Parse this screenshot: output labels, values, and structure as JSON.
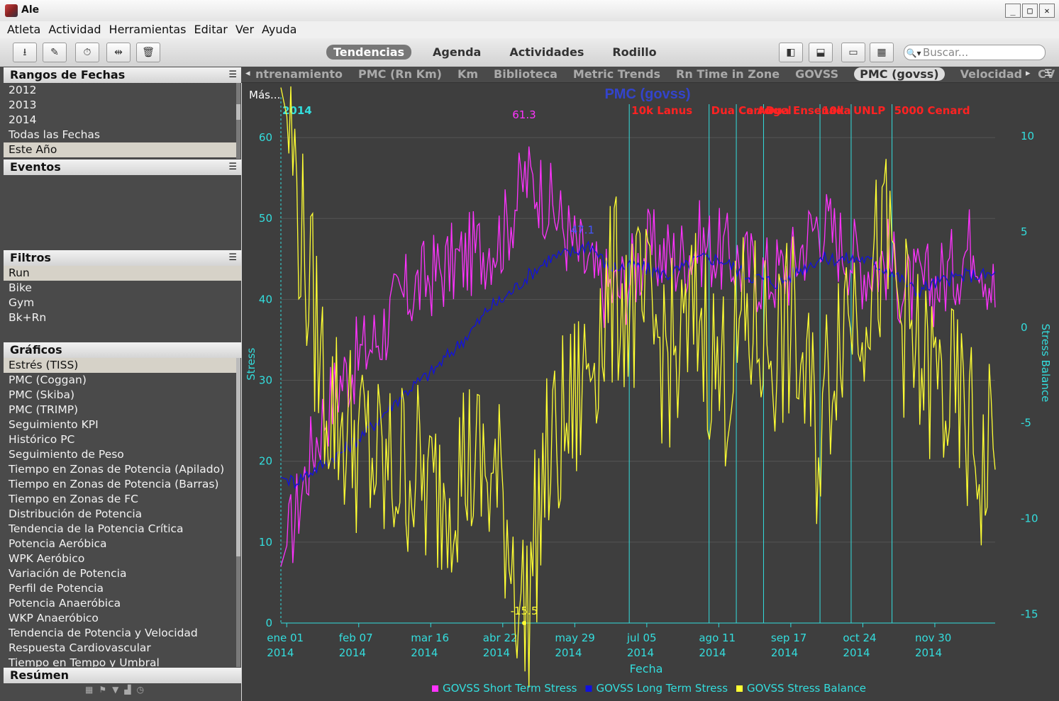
{
  "window": {
    "title": "Ale"
  },
  "menu": [
    "Atleta",
    "Actividad",
    "Herramientas",
    "Editar",
    "Ver",
    "Ayuda"
  ],
  "toolbar": {
    "views": [
      "Tendencias",
      "Agenda",
      "Actividades",
      "Rodillo"
    ],
    "active_view": "Tendencias",
    "search_placeholder": "Buscar..."
  },
  "sidebar": {
    "rangos": {
      "title": "Rangos de Fechas",
      "items": [
        "2012",
        "2013",
        "2014",
        "Todas las Fechas",
        "Este Año"
      ],
      "selected": "Este Año"
    },
    "eventos": {
      "title": "Eventos"
    },
    "filtros": {
      "title": "Filtros",
      "items": [
        "Run",
        "Bike",
        "Gym",
        "Bk+Rn"
      ],
      "selected": "Run"
    },
    "graficos": {
      "title": "Gráficos",
      "items": [
        "Estrés (TISS)",
        "PMC (Coggan)",
        "PMC (Skiba)",
        "PMC (TRIMP)",
        "Seguimiento KPI",
        "Histórico PC",
        "Seguimiento de Peso",
        "Tiempo en Zonas de Potencia (Apilado)",
        "Tiempo en Zonas de Potencia (Barras)",
        "Tiempo en Zonas de FC",
        "Distribución de Potencia",
        "Tendencia de la Potencia Crítica",
        "Potencia Aeróbica",
        "WPK Aeróbico",
        "Variación de Potencia",
        "Perfil de Potencia",
        "Potencia Anaeróbica",
        "WKP Anaeróbico",
        "Tendencia de Potencia y Velocidad",
        "Respuesta Cardiovascular",
        "Tiempo en Tempo y Umbral"
      ],
      "selected": "Estrés (TISS)"
    },
    "resumen": {
      "title": "Resúmen"
    }
  },
  "chart_tabs": [
    "ntrenamiento",
    "PMC (Rn Km)",
    "Km",
    "Biblioteca",
    "Metric Trends",
    "Rn Time in Zone",
    "GOVSS",
    "PMC (govss)",
    "Velocidad",
    "CV"
  ],
  "active_chart_tab": "PMC (govss)",
  "mas_label": "Más...",
  "chart_data": {
    "type": "line",
    "title": "PMC (govss)",
    "xlabel": "Fecha",
    "ylabel": "Stress",
    "y2label": "Stress Balance",
    "x_range": [
      "2013-12-29",
      "2014-12-31"
    ],
    "ylim": [
      0,
      65
    ],
    "y2lim": [
      -15.5,
      12
    ],
    "yticks": [
      0,
      10,
      20,
      30,
      40,
      50,
      60
    ],
    "y2ticks": [
      -15,
      -10,
      -5,
      0,
      5,
      10
    ],
    "xticks": [
      {
        "date": "2014-01-01",
        "label1": "ene 01",
        "label2": "2014"
      },
      {
        "date": "2014-02-07",
        "label1": "feb 07",
        "label2": "2014"
      },
      {
        "date": "2014-03-16",
        "label1": "mar 16",
        "label2": "2014"
      },
      {
        "date": "2014-04-22",
        "label1": "abr 22",
        "label2": "2014"
      },
      {
        "date": "2014-05-29",
        "label1": "may 29",
        "label2": "2014"
      },
      {
        "date": "2014-07-05",
        "label1": "jul 05",
        "label2": "2014"
      },
      {
        "date": "2014-08-11",
        "label1": "ago 11",
        "label2": "2014"
      },
      {
        "date": "2014-09-17",
        "label1": "sep 17",
        "label2": "2014"
      },
      {
        "date": "2014-10-24",
        "label1": "oct 24",
        "label2": "2014"
      },
      {
        "date": "2014-11-30",
        "label1": "nov 30",
        "label2": "2014"
      }
    ],
    "year_marker": {
      "date": "2013-12-29",
      "label": "2014"
    },
    "events": [
      {
        "date": "2014-06-26",
        "label": "10k Lanus"
      },
      {
        "date": "2014-08-06",
        "label": "Dua Cerro"
      },
      {
        "date": "2014-08-20",
        "label": "Ca Angel"
      },
      {
        "date": "2014-09-03",
        "label": "Dua Ensenada"
      },
      {
        "date": "2014-10-02",
        "label": "10k"
      },
      {
        "date": "2014-10-18",
        "label": "UNLP"
      },
      {
        "date": "2014-11-08",
        "label": "5000 Cenard"
      }
    ],
    "annotations": [
      {
        "series": "GOVSS Short Term Stress",
        "date": "2014-05-03",
        "value": 61.3,
        "label": "61.3"
      },
      {
        "series": "GOVSS Long Term Stress",
        "date": "2014-06-02",
        "value": 47.1,
        "label": "47.1"
      },
      {
        "series": "GOVSS Stress Balance",
        "date": "2014-05-03",
        "value": -15.5,
        "label": "-15.5"
      }
    ],
    "series": [
      {
        "name": "GOVSS Short Term Stress",
        "color": "#ff33ff",
        "axis": "left",
        "points": [
          [
            "2013-12-29",
            7
          ],
          [
            "2014-01-05",
            13
          ],
          [
            "2014-01-12",
            20
          ],
          [
            "2014-01-20",
            26
          ],
          [
            "2014-01-28",
            30
          ],
          [
            "2014-02-07",
            33
          ],
          [
            "2014-02-18",
            36
          ],
          [
            "2014-03-01",
            40
          ],
          [
            "2014-03-16",
            43
          ],
          [
            "2014-04-01",
            45
          ],
          [
            "2014-04-15",
            47
          ],
          [
            "2014-04-22",
            48
          ],
          [
            "2014-05-03",
            55
          ],
          [
            "2014-05-10",
            54
          ],
          [
            "2014-05-20",
            50
          ],
          [
            "2014-05-29",
            46
          ],
          [
            "2014-06-10",
            42
          ],
          [
            "2014-06-20",
            41
          ],
          [
            "2014-07-05",
            46
          ],
          [
            "2014-07-20",
            45
          ],
          [
            "2014-08-01",
            47
          ],
          [
            "2014-08-11",
            46
          ],
          [
            "2014-08-25",
            44
          ],
          [
            "2014-09-05",
            43
          ],
          [
            "2014-09-17",
            44
          ],
          [
            "2014-10-01",
            50
          ],
          [
            "2014-10-12",
            47
          ],
          [
            "2014-10-24",
            44
          ],
          [
            "2014-11-05",
            45
          ],
          [
            "2014-11-15",
            41
          ],
          [
            "2014-11-30",
            42
          ],
          [
            "2014-12-10",
            44
          ],
          [
            "2014-12-20",
            48
          ],
          [
            "2014-12-31",
            40
          ]
        ]
      },
      {
        "name": "GOVSS Long Term Stress",
        "color": "#1111dd",
        "axis": "left",
        "points": [
          [
            "2013-12-29",
            18
          ],
          [
            "2014-01-05",
            17.5
          ],
          [
            "2014-01-15",
            19
          ],
          [
            "2014-01-28",
            21
          ],
          [
            "2014-02-07",
            23
          ],
          [
            "2014-02-20",
            26
          ],
          [
            "2014-03-05",
            29
          ],
          [
            "2014-03-16",
            31
          ],
          [
            "2014-04-01",
            35
          ],
          [
            "2014-04-15",
            39
          ],
          [
            "2014-04-22",
            40
          ],
          [
            "2014-05-05",
            43
          ],
          [
            "2014-05-15",
            45
          ],
          [
            "2014-05-29",
            46
          ],
          [
            "2014-06-05",
            47
          ],
          [
            "2014-06-15",
            44
          ],
          [
            "2014-07-01",
            44
          ],
          [
            "2014-07-15",
            43
          ],
          [
            "2014-08-01",
            45
          ],
          [
            "2014-08-11",
            45
          ],
          [
            "2014-08-25",
            43
          ],
          [
            "2014-09-10",
            42
          ],
          [
            "2014-09-17",
            43
          ],
          [
            "2014-10-01",
            45
          ],
          [
            "2014-10-24",
            45
          ],
          [
            "2014-11-10",
            43
          ],
          [
            "2014-11-20",
            41
          ],
          [
            "2014-11-30",
            42
          ],
          [
            "2014-12-15",
            43
          ],
          [
            "2014-12-31",
            43
          ]
        ]
      },
      {
        "name": "GOVSS Stress Balance",
        "color": "#ffff33",
        "axis": "right",
        "points": [
          [
            "2013-12-29",
            12.5
          ],
          [
            "2014-01-03",
            10
          ],
          [
            "2014-01-08",
            5
          ],
          [
            "2014-01-14",
            1
          ],
          [
            "2014-01-20",
            -3
          ],
          [
            "2014-01-28",
            -5
          ],
          [
            "2014-02-07",
            -6
          ],
          [
            "2014-02-20",
            -8
          ],
          [
            "2014-03-05",
            -7
          ],
          [
            "2014-03-16",
            -9
          ],
          [
            "2014-04-01",
            -7
          ],
          [
            "2014-04-15",
            -8
          ],
          [
            "2014-04-22",
            -9
          ],
          [
            "2014-05-03",
            -15.5
          ],
          [
            "2014-05-12",
            -8
          ],
          [
            "2014-05-20",
            -6
          ],
          [
            "2014-05-29",
            -4
          ],
          [
            "2014-06-10",
            0
          ],
          [
            "2014-06-20",
            2
          ],
          [
            "2014-07-05",
            0
          ],
          [
            "2014-07-20",
            -2
          ],
          [
            "2014-08-01",
            1
          ],
          [
            "2014-08-11",
            -3
          ],
          [
            "2014-08-25",
            0
          ],
          [
            "2014-09-10",
            -1
          ],
          [
            "2014-09-17",
            0
          ],
          [
            "2014-10-01",
            -6
          ],
          [
            "2014-10-12",
            1
          ],
          [
            "2014-10-24",
            2
          ],
          [
            "2014-11-05",
            4
          ],
          [
            "2014-11-20",
            -2
          ],
          [
            "2014-11-30",
            -3
          ],
          [
            "2014-12-15",
            -5
          ],
          [
            "2014-12-25",
            -8
          ],
          [
            "2014-12-31",
            -3
          ]
        ]
      }
    ],
    "legend": {
      "placement": "bottom",
      "items": [
        "GOVSS Short Term Stress",
        "GOVSS Long Term Stress",
        "GOVSS Stress Balance"
      ]
    },
    "grid": true
  }
}
